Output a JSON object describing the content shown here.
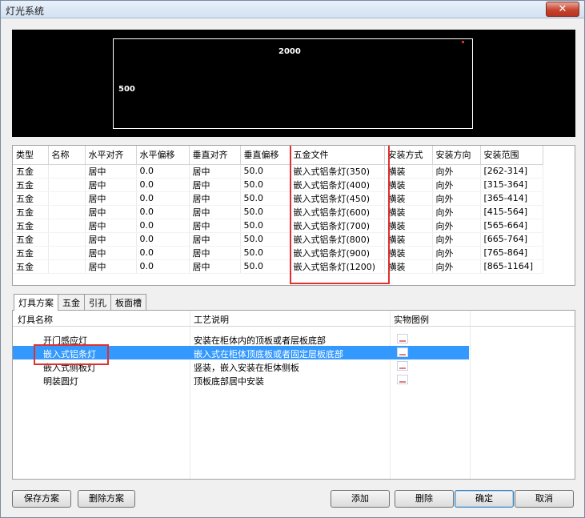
{
  "window": {
    "title": "灯光系统",
    "close_glyph": "✕"
  },
  "preview": {
    "width_label": "2000",
    "height_label": "500",
    "accent": "#d33333"
  },
  "grid": {
    "headers": [
      "类型",
      "名称",
      "水平对齐",
      "水平偏移",
      "垂直对齐",
      "垂直偏移",
      "五金文件",
      "安装方式",
      "安装方向",
      "安装范围"
    ],
    "rows": [
      [
        "五金",
        "",
        "居中",
        "0.0",
        "居中",
        "50.0",
        "嵌入式铝条灯(350)",
        "横装",
        "向外",
        "[262-314]"
      ],
      [
        "五金",
        "",
        "居中",
        "0.0",
        "居中",
        "50.0",
        "嵌入式铝条灯(400)",
        "横装",
        "向外",
        "[315-364]"
      ],
      [
        "五金",
        "",
        "居中",
        "0.0",
        "居中",
        "50.0",
        "嵌入式铝条灯(450)",
        "横装",
        "向外",
        "[365-414]"
      ],
      [
        "五金",
        "",
        "居中",
        "0.0",
        "居中",
        "50.0",
        "嵌入式铝条灯(600)",
        "横装",
        "向外",
        "[415-564]"
      ],
      [
        "五金",
        "",
        "居中",
        "0.0",
        "居中",
        "50.0",
        "嵌入式铝条灯(700)",
        "横装",
        "向外",
        "[565-664]"
      ],
      [
        "五金",
        "",
        "居中",
        "0.0",
        "居中",
        "50.0",
        "嵌入式铝条灯(800)",
        "横装",
        "向外",
        "[665-764]"
      ],
      [
        "五金",
        "",
        "居中",
        "0.0",
        "居中",
        "50.0",
        "嵌入式铝条灯(900)",
        "横装",
        "向外",
        "[765-864]"
      ],
      [
        "五金",
        "",
        "居中",
        "0.0",
        "居中",
        "50.0",
        "嵌入式铝条灯(1200)",
        "横装",
        "向外",
        "[865-1164]"
      ]
    ]
  },
  "tabs": [
    "灯具方案",
    "五金",
    "引孔",
    "板面槽"
  ],
  "list": {
    "headers": [
      "灯具名称",
      "工艺说明",
      "实物图例"
    ],
    "rows": [
      {
        "name": "开门感应灯",
        "desc": "安装在柜体内的顶板或者层板底部",
        "selected": false
      },
      {
        "name": "嵌入式铝条灯",
        "desc": "嵌入式在柜体顶底板或者固定层板底部",
        "selected": true
      },
      {
        "name": "嵌入式侧板灯",
        "desc": "竖装，嵌入安装在柜体侧板",
        "selected": false
      },
      {
        "name": "明装圆灯",
        "desc": "顶板底部居中安装",
        "selected": false
      }
    ],
    "selection_color": "#3399ff",
    "highlight_color": "#e03030"
  },
  "buttons": {
    "save_scheme": "保存方案",
    "delete_scheme": "删除方案",
    "add": "添加",
    "delete": "删除",
    "ok": "确定",
    "cancel": "取消"
  }
}
